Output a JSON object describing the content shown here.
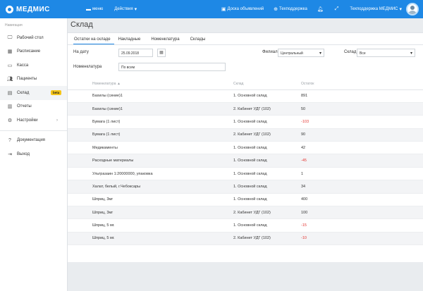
{
  "brand": {
    "name": "МЕДМИС"
  },
  "topbar": {
    "menu_label": "меню",
    "actions_label": "Действия",
    "board_label": "Доска объявлений",
    "support_label": "Техподдержка",
    "user_label": "Техподдержка МЕДМИС"
  },
  "sidebar": {
    "heading": "Навигация",
    "items": [
      {
        "label": "Рабочий стол",
        "icon": "monitor-icon"
      },
      {
        "label": "Расписание",
        "icon": "calendar-icon"
      },
      {
        "label": "Касса",
        "icon": "cash-icon"
      },
      {
        "label": "Пациенты",
        "icon": "users-icon"
      },
      {
        "label": "Склад",
        "icon": "warehouse-icon",
        "badge": "beta"
      },
      {
        "label": "Отчеты",
        "icon": "bar-chart-icon"
      },
      {
        "label": "Настройки",
        "icon": "gear-icon"
      }
    ],
    "docs_label": "Документация",
    "exit_label": "Выход"
  },
  "page": {
    "title": "Склад"
  },
  "tabs": [
    "Остатки на складе",
    "Накладные",
    "Номенклатура",
    "Склады"
  ],
  "filters": {
    "date_label": "На дату",
    "date_value": "25.09.2018",
    "branch_label": "Филиал",
    "branch_value": "Центральный",
    "warehouse_label": "Склад",
    "warehouse_value": "Все",
    "nomenclature_label": "Номенклатура",
    "nomenclature_value": "По всем"
  },
  "table": {
    "headers": [
      "Номенклатура ▲",
      "Склад",
      "Остаток"
    ],
    "rows": [
      {
        "name": "Бахилы (синие)1",
        "warehouse": "1. Основной склад",
        "qty": "891"
      },
      {
        "name": "Бахилы (синие)1",
        "warehouse": "2. Кабинет УДГ (102)",
        "qty": "50"
      },
      {
        "name": "Бумага (1 лист)",
        "warehouse": "1. Основной склад",
        "qty": "-103"
      },
      {
        "name": "Бумага (1 лист)",
        "warehouse": "2. Кабинет УДГ (102)",
        "qty": "90"
      },
      {
        "name": "Медикаменты",
        "warehouse": "1. Основной склад",
        "qty": "42"
      },
      {
        "name": "Расходные материалы",
        "warehouse": "1. Основной склад",
        "qty": "-45"
      },
      {
        "name": "Ультразаин 1:20000000, упаковка",
        "warehouse": "1. Основной склад",
        "qty": "1"
      },
      {
        "name": "Халат, белый, г.Чебоксары",
        "warehouse": "1. Основной склад",
        "qty": "34"
      },
      {
        "name": "Шприц, 3мг",
        "warehouse": "1. Основной склад",
        "qty": "400"
      },
      {
        "name": "Шприц, 3мг",
        "warehouse": "2. Кабинет УДГ (102)",
        "qty": "100"
      },
      {
        "name": "Шприц, 5 мг.",
        "warehouse": "1. Основной склад",
        "qty": "-15"
      },
      {
        "name": "Шприц, 5 мг.",
        "warehouse": "2. Кабинет УДГ (102)",
        "qty": "-10"
      }
    ]
  },
  "colors": {
    "accent": "#1e88e5",
    "negative": "#e53935",
    "badge": "#f5c518"
  }
}
